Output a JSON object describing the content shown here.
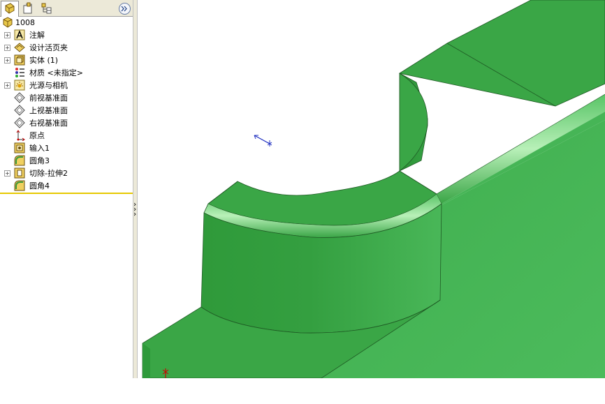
{
  "tabs": [
    {
      "name": "feature-manager",
      "icon": "feature-tree-icon"
    },
    {
      "name": "property-manager",
      "icon": "property-manager-icon"
    },
    {
      "name": "configuration-manager",
      "icon": "configuration-manager-icon"
    }
  ],
  "expand_icon": "double-chevron-right-icon",
  "tree": {
    "root": {
      "label": "1008",
      "icon": "part-icon"
    },
    "items": [
      {
        "label": "注解",
        "icon": "annotations-icon",
        "expandable": true
      },
      {
        "label": "设计活页夹",
        "icon": "design-binder-icon",
        "expandable": true
      },
      {
        "label": "实体 (1)",
        "icon": "solid-bodies-icon",
        "expandable": true
      },
      {
        "label": "材质 <未指定>",
        "icon": "material-icon",
        "expandable": false
      },
      {
        "label": "光源与相机",
        "icon": "lights-cameras-icon",
        "expandable": true
      },
      {
        "label": "前视基准面",
        "icon": "plane-icon",
        "expandable": false
      },
      {
        "label": "上视基准面",
        "icon": "plane-icon",
        "expandable": false
      },
      {
        "label": "右视基准面",
        "icon": "plane-icon",
        "expandable": false
      },
      {
        "label": "原点",
        "icon": "origin-icon",
        "expandable": false
      },
      {
        "label": "输入1",
        "icon": "imported-body-icon",
        "expandable": false
      },
      {
        "label": "圆角3",
        "icon": "fillet-icon",
        "expandable": false
      },
      {
        "label": "切除-拉伸2",
        "icon": "cut-extrude-icon",
        "expandable": true
      },
      {
        "label": "圆角4",
        "icon": "fillet-icon",
        "expandable": false
      }
    ]
  },
  "colors": {
    "model_face_light": "#48b85a",
    "model_face_mid": "#3aa546",
    "model_face_dark": "#2f9a3a",
    "rollback_bar": "#e6c800",
    "panel_bg": "#ece9d8"
  }
}
